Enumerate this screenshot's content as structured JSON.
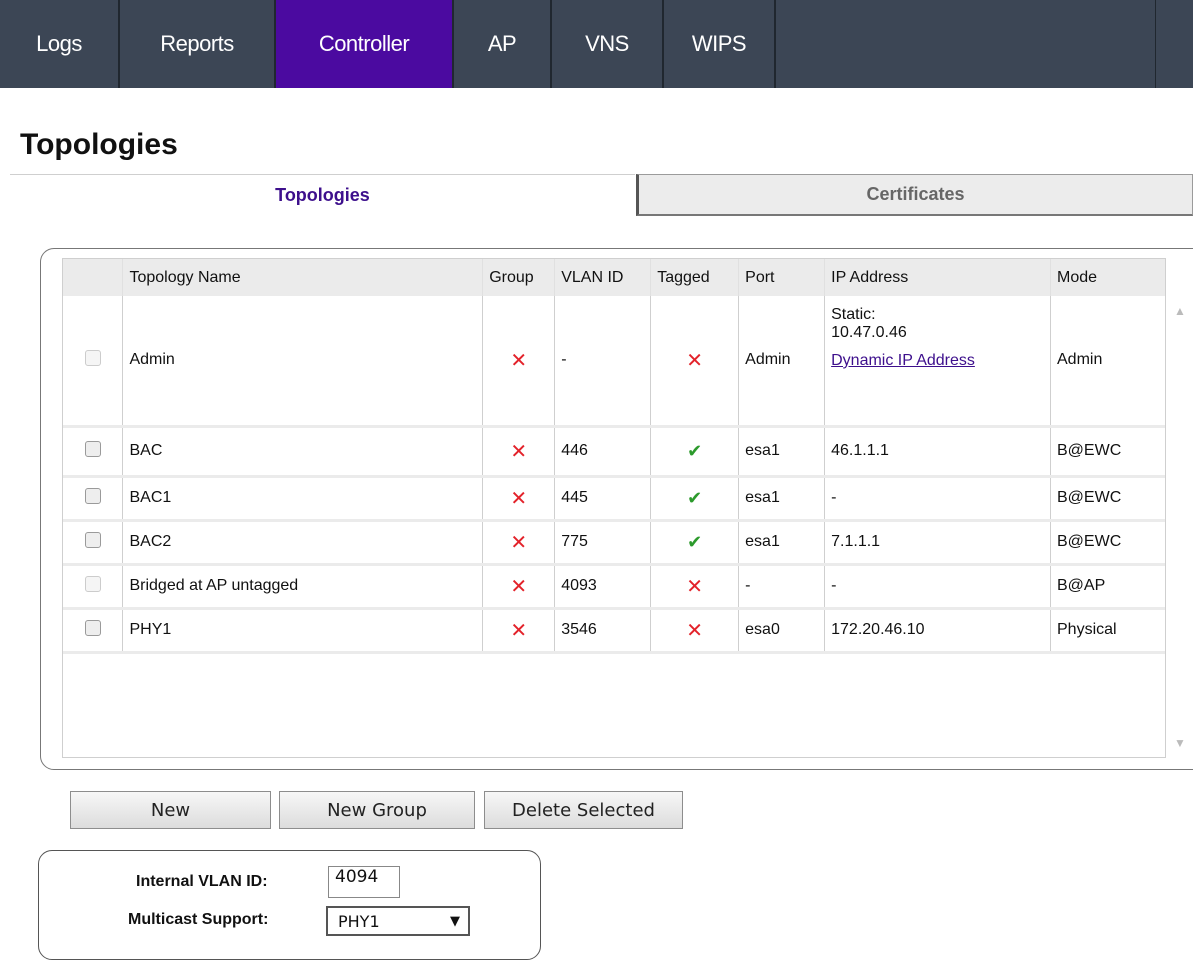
{
  "nav": {
    "tabs": [
      {
        "label": "Logs"
      },
      {
        "label": "Reports"
      },
      {
        "label": "Controller"
      },
      {
        "label": "AP"
      },
      {
        "label": "VNS"
      },
      {
        "label": "WIPS"
      }
    ],
    "active": "Controller"
  },
  "page": {
    "title": "Topologies"
  },
  "subtabs": [
    {
      "label": "Topologies"
    },
    {
      "label": "Certificates"
    }
  ],
  "table": {
    "columns": [
      "Topology Name",
      "Group",
      "VLAN ID",
      "Tagged",
      "Port",
      "IP Address",
      "Mode"
    ],
    "rows": [
      {
        "name": "Admin",
        "group": "✕",
        "vlan": "-",
        "tagged": "✕",
        "port": "Admin",
        "ip_line1": "Static:",
        "ip_line2": "10.47.0.46",
        "ip_link": "Dynamic IP Address",
        "mode": "Admin"
      },
      {
        "name": "BAC",
        "group": "✕",
        "vlan": "446",
        "tagged": "✔",
        "port": "esa1",
        "ip": "46.1.1.1",
        "mode": "B@EWC"
      },
      {
        "name": "BAC1",
        "group": "✕",
        "vlan": "445",
        "tagged": "✔",
        "port": "esa1",
        "ip": "-",
        "mode": "B@EWC"
      },
      {
        "name": "BAC2",
        "group": "✕",
        "vlan": "775",
        "tagged": "✔",
        "port": "esa1",
        "ip": "7.1.1.1",
        "mode": "B@EWC"
      },
      {
        "name": "Bridged at AP untagged",
        "group": "✕",
        "vlan": "4093",
        "tagged": "✕",
        "port": "-",
        "ip": "-",
        "mode": "B@AP"
      },
      {
        "name": "PHY1",
        "group": "✕",
        "vlan": "3546",
        "tagged": "✕",
        "port": "esa0",
        "ip": "172.20.46.10",
        "mode": "Physical"
      }
    ]
  },
  "buttons": {
    "new": "New",
    "new_group": "New Group",
    "delete_selected": "Delete Selected"
  },
  "settings": {
    "internal_vlan_label": "Internal VLAN ID:",
    "internal_vlan_value": "4094",
    "multicast_label": "Multicast Support:",
    "multicast_value": "PHY1"
  },
  "icons": {
    "checkmark": "check-icon",
    "cross": "x-icon",
    "dropdown": "triangle-down-icon"
  },
  "colors": {
    "nav_bg": "#3c4655",
    "nav_active": "#4b0aa0",
    "cross": "#e3222a",
    "check": "#2c9a2c",
    "link": "#3d0f8c"
  }
}
